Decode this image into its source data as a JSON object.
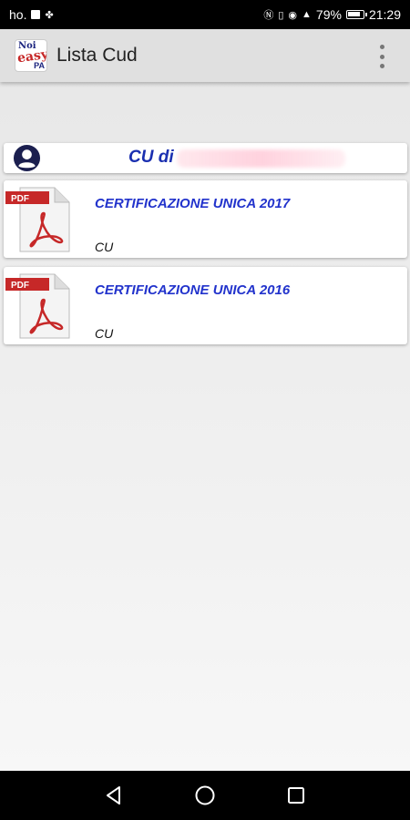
{
  "status_bar": {
    "carrier": "ho.",
    "battery": "79%",
    "time": "21:29"
  },
  "app_bar": {
    "logo_text": [
      "Noi",
      "easy",
      "PA"
    ],
    "title": "Lista Cud"
  },
  "header": {
    "title": "CU di"
  },
  "documents": [
    {
      "title": "CERTIFICAZIONE UNICA 2017",
      "subtitle": "CU",
      "badge": "PDF"
    },
    {
      "title": "CERTIFICAZIONE UNICA 2016",
      "subtitle": "CU",
      "badge": "PDF"
    }
  ],
  "colors": {
    "title_blue": "#1a2fb0",
    "doc_title_blue": "#2233cc",
    "pdf_red": "#c62828"
  },
  "icons": {
    "avatar": "account-circle-icon",
    "document": "pdf-file-icon",
    "menu": "overflow-menu-icon",
    "nav": [
      "back-icon",
      "home-icon",
      "recents-icon"
    ]
  }
}
